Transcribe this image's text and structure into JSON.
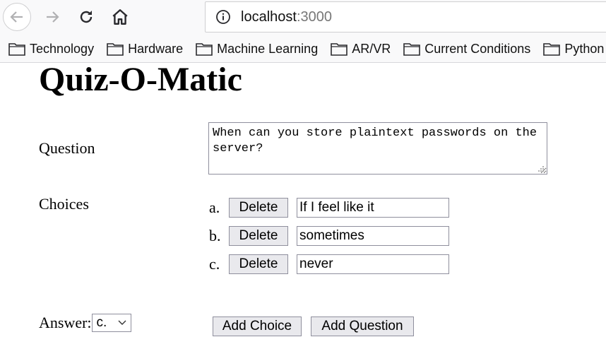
{
  "browser": {
    "url_host": "localhost",
    "url_port": ":3000",
    "icons": [
      "back-icon",
      "forward-icon",
      "reload-icon",
      "home-icon",
      "info-icon",
      "folder-icon"
    ]
  },
  "bookmarks": [
    "Technology",
    "Hardware",
    "Machine Learning",
    "AR/VR",
    "Current Conditions",
    "Python"
  ],
  "page": {
    "title": "Quiz-O-Matic",
    "question_label": "Question",
    "question_text": "When can you store plaintext passwords on the server?",
    "choices_label": "Choices",
    "choices": [
      {
        "letter": "a.",
        "delete_label": "Delete",
        "value": "If I feel like it"
      },
      {
        "letter": "b.",
        "delete_label": "Delete",
        "value": "sometimes"
      },
      {
        "letter": "c.",
        "delete_label": "Delete",
        "value": "never"
      }
    ],
    "answer_label": "Answer:",
    "answer_value": "c.",
    "add_choice_label": "Add Choice",
    "add_question_label": "Add Question"
  }
}
